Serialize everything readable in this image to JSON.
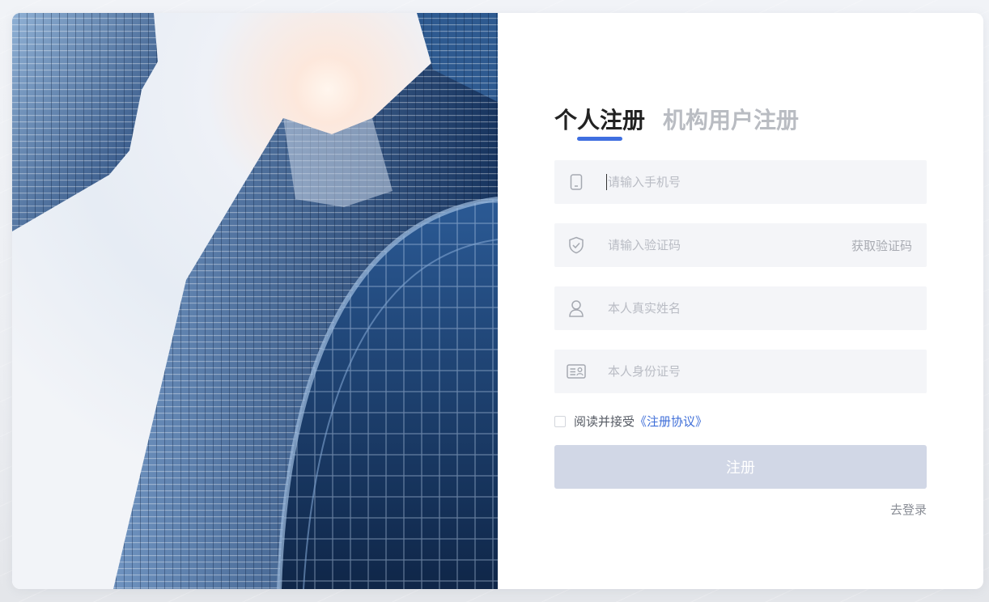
{
  "tabs": [
    {
      "label": "个人注册",
      "active": true
    },
    {
      "label": "机构用户注册",
      "active": false
    }
  ],
  "fields": {
    "phone": {
      "placeholder": "请输入手机号",
      "icon": "phone-icon"
    },
    "code": {
      "placeholder": "请输入验证码",
      "icon": "shield-check-icon",
      "action_label": "获取验证码"
    },
    "name": {
      "placeholder": "本人真实姓名",
      "icon": "user-icon"
    },
    "id_number": {
      "placeholder": "本人身份证号",
      "icon": "id-card-icon"
    }
  },
  "agreement": {
    "prefix": "阅读并接受",
    "link_label": "《注册协议》",
    "checked": false
  },
  "submit_label": "注册",
  "login_link": "去登录",
  "colors": {
    "accent": "#3f6fe0",
    "field_bg": "#f4f5f8",
    "button_disabled": "#d1d7e6",
    "link": "#3e6ed8"
  }
}
